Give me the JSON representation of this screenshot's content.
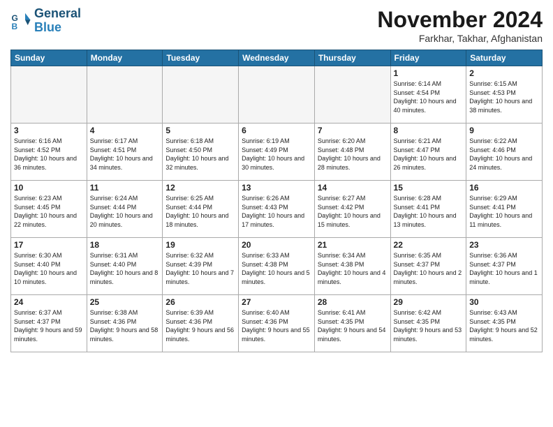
{
  "logo": {
    "line1": "General",
    "line2": "Blue"
  },
  "title": "November 2024",
  "location": "Farkhar, Takhar, Afghanistan",
  "headers": [
    "Sunday",
    "Monday",
    "Tuesday",
    "Wednesday",
    "Thursday",
    "Friday",
    "Saturday"
  ],
  "rows": [
    [
      {
        "day": "",
        "info": "",
        "empty": true
      },
      {
        "day": "",
        "info": "",
        "empty": true
      },
      {
        "day": "",
        "info": "",
        "empty": true
      },
      {
        "day": "",
        "info": "",
        "empty": true
      },
      {
        "day": "",
        "info": "",
        "empty": true
      },
      {
        "day": "1",
        "info": "Sunrise: 6:14 AM\nSunset: 4:54 PM\nDaylight: 10 hours and 40 minutes."
      },
      {
        "day": "2",
        "info": "Sunrise: 6:15 AM\nSunset: 4:53 PM\nDaylight: 10 hours and 38 minutes."
      }
    ],
    [
      {
        "day": "3",
        "info": "Sunrise: 6:16 AM\nSunset: 4:52 PM\nDaylight: 10 hours and 36 minutes."
      },
      {
        "day": "4",
        "info": "Sunrise: 6:17 AM\nSunset: 4:51 PM\nDaylight: 10 hours and 34 minutes."
      },
      {
        "day": "5",
        "info": "Sunrise: 6:18 AM\nSunset: 4:50 PM\nDaylight: 10 hours and 32 minutes."
      },
      {
        "day": "6",
        "info": "Sunrise: 6:19 AM\nSunset: 4:49 PM\nDaylight: 10 hours and 30 minutes."
      },
      {
        "day": "7",
        "info": "Sunrise: 6:20 AM\nSunset: 4:48 PM\nDaylight: 10 hours and 28 minutes."
      },
      {
        "day": "8",
        "info": "Sunrise: 6:21 AM\nSunset: 4:47 PM\nDaylight: 10 hours and 26 minutes."
      },
      {
        "day": "9",
        "info": "Sunrise: 6:22 AM\nSunset: 4:46 PM\nDaylight: 10 hours and 24 minutes."
      }
    ],
    [
      {
        "day": "10",
        "info": "Sunrise: 6:23 AM\nSunset: 4:45 PM\nDaylight: 10 hours and 22 minutes."
      },
      {
        "day": "11",
        "info": "Sunrise: 6:24 AM\nSunset: 4:44 PM\nDaylight: 10 hours and 20 minutes."
      },
      {
        "day": "12",
        "info": "Sunrise: 6:25 AM\nSunset: 4:44 PM\nDaylight: 10 hours and 18 minutes."
      },
      {
        "day": "13",
        "info": "Sunrise: 6:26 AM\nSunset: 4:43 PM\nDaylight: 10 hours and 17 minutes."
      },
      {
        "day": "14",
        "info": "Sunrise: 6:27 AM\nSunset: 4:42 PM\nDaylight: 10 hours and 15 minutes."
      },
      {
        "day": "15",
        "info": "Sunrise: 6:28 AM\nSunset: 4:41 PM\nDaylight: 10 hours and 13 minutes."
      },
      {
        "day": "16",
        "info": "Sunrise: 6:29 AM\nSunset: 4:41 PM\nDaylight: 10 hours and 11 minutes."
      }
    ],
    [
      {
        "day": "17",
        "info": "Sunrise: 6:30 AM\nSunset: 4:40 PM\nDaylight: 10 hours and 10 minutes."
      },
      {
        "day": "18",
        "info": "Sunrise: 6:31 AM\nSunset: 4:40 PM\nDaylight: 10 hours and 8 minutes."
      },
      {
        "day": "19",
        "info": "Sunrise: 6:32 AM\nSunset: 4:39 PM\nDaylight: 10 hours and 7 minutes."
      },
      {
        "day": "20",
        "info": "Sunrise: 6:33 AM\nSunset: 4:38 PM\nDaylight: 10 hours and 5 minutes."
      },
      {
        "day": "21",
        "info": "Sunrise: 6:34 AM\nSunset: 4:38 PM\nDaylight: 10 hours and 4 minutes."
      },
      {
        "day": "22",
        "info": "Sunrise: 6:35 AM\nSunset: 4:37 PM\nDaylight: 10 hours and 2 minutes."
      },
      {
        "day": "23",
        "info": "Sunrise: 6:36 AM\nSunset: 4:37 PM\nDaylight: 10 hours and 1 minute."
      }
    ],
    [
      {
        "day": "24",
        "info": "Sunrise: 6:37 AM\nSunset: 4:37 PM\nDaylight: 9 hours and 59 minutes."
      },
      {
        "day": "25",
        "info": "Sunrise: 6:38 AM\nSunset: 4:36 PM\nDaylight: 9 hours and 58 minutes."
      },
      {
        "day": "26",
        "info": "Sunrise: 6:39 AM\nSunset: 4:36 PM\nDaylight: 9 hours and 56 minutes."
      },
      {
        "day": "27",
        "info": "Sunrise: 6:40 AM\nSunset: 4:36 PM\nDaylight: 9 hours and 55 minutes."
      },
      {
        "day": "28",
        "info": "Sunrise: 6:41 AM\nSunset: 4:35 PM\nDaylight: 9 hours and 54 minutes."
      },
      {
        "day": "29",
        "info": "Sunrise: 6:42 AM\nSunset: 4:35 PM\nDaylight: 9 hours and 53 minutes."
      },
      {
        "day": "30",
        "info": "Sunrise: 6:43 AM\nSunset: 4:35 PM\nDaylight: 9 hours and 52 minutes."
      }
    ]
  ]
}
